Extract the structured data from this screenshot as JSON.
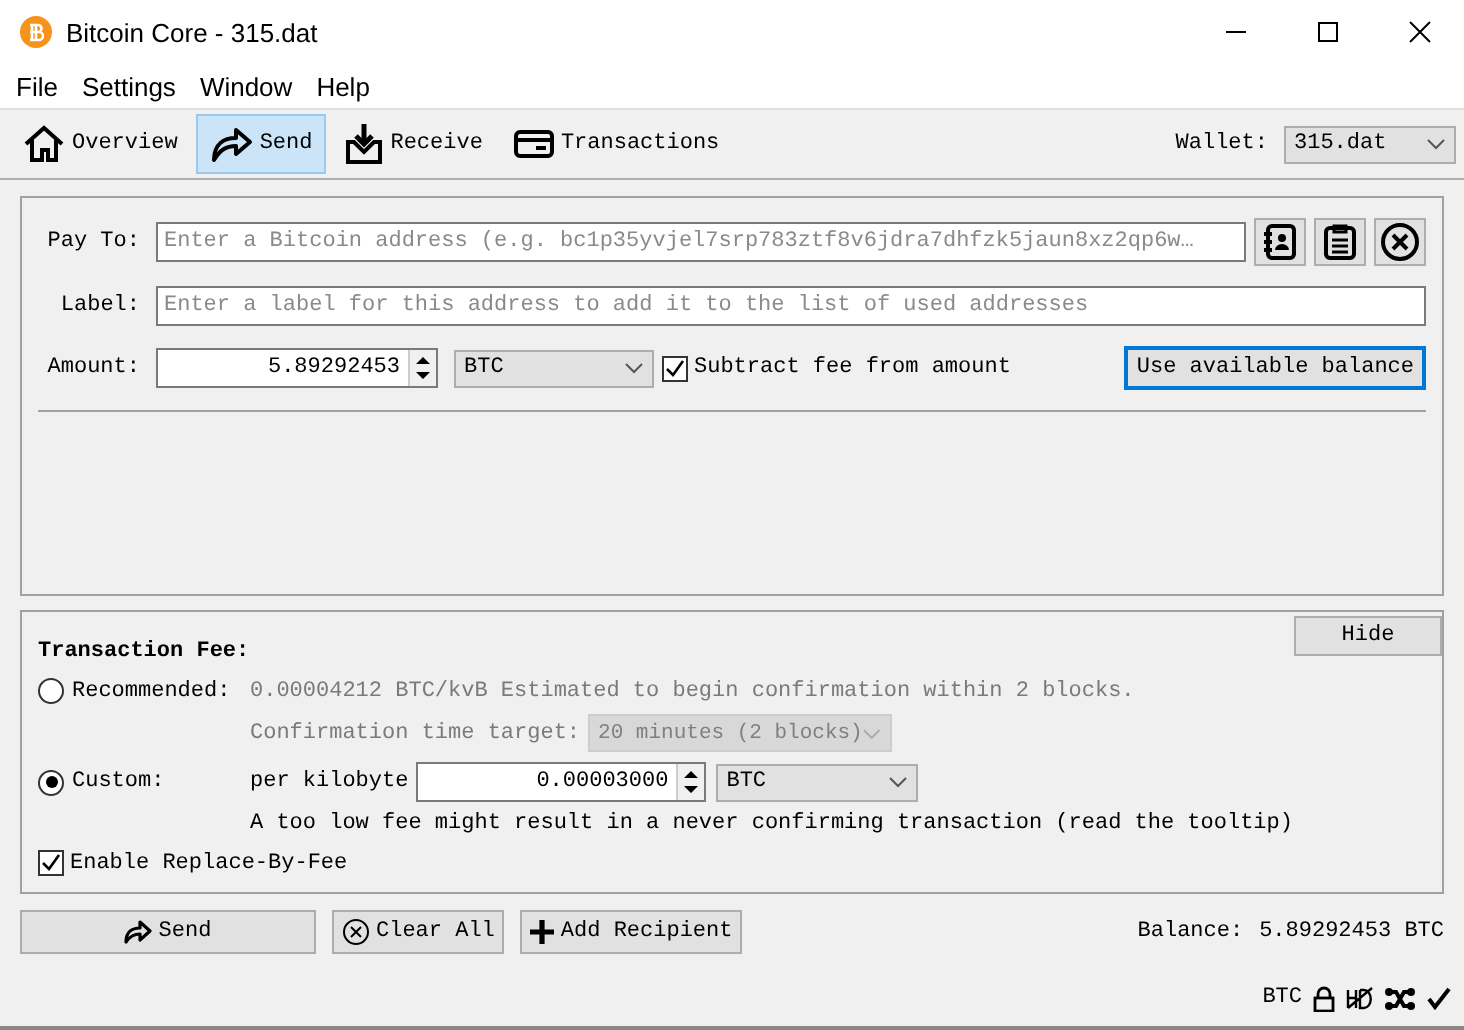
{
  "window": {
    "title": "Bitcoin Core - 315.dat"
  },
  "menu": [
    "File",
    "Settings",
    "Window",
    "Help"
  ],
  "tabs": [
    {
      "label": "Overview",
      "selected": false
    },
    {
      "label": "Send",
      "selected": true
    },
    {
      "label": "Receive",
      "selected": false
    },
    {
      "label": "Transactions",
      "selected": false
    }
  ],
  "wallet": {
    "label": "Wallet:",
    "value": "315.dat"
  },
  "recipient": {
    "pay_to_label": "Pay To:",
    "pay_to_placeholder": "Enter a Bitcoin address (e.g. bc1p35yvjel7srp783ztf8v6jdra7dhfzk5jaun8xz2qp6w…",
    "label_label": "Label:",
    "label_placeholder": "Enter a label for this address to add it to the list of used addresses",
    "amount_label": "Amount:",
    "amount": "5.89292453",
    "unit": "BTC",
    "subtract_fee": {
      "label": "Subtract fee from amount",
      "checked": true
    },
    "use_balance_button": "Use available balance"
  },
  "fee": {
    "title": "Transaction Fee:",
    "hide_button": "Hide",
    "options": [
      {
        "label": "Recommended:",
        "selected": false
      },
      {
        "label": "Custom:",
        "selected": true
      }
    ],
    "recommended_text": "0.00004212 BTC/kvB Estimated to begin confirmation within 2 blocks.",
    "target_label": "Confirmation time target:",
    "target_value": "20 minutes (2 blocks)",
    "per_kilobyte_label": "per kilobyte",
    "custom_fee": "0.00003000",
    "custom_unit": "BTC",
    "warning": "A too low fee might result in a never confirming transaction (read the tooltip)",
    "rbf": {
      "label": "Enable Replace-By-Fee",
      "checked": true
    }
  },
  "actions": [
    "Send",
    "Clear All",
    "Add Recipient"
  ],
  "balance": {
    "label": "Balance:",
    "value": "5.89292453 BTC"
  },
  "status_bar": {
    "unit": "BTC"
  }
}
